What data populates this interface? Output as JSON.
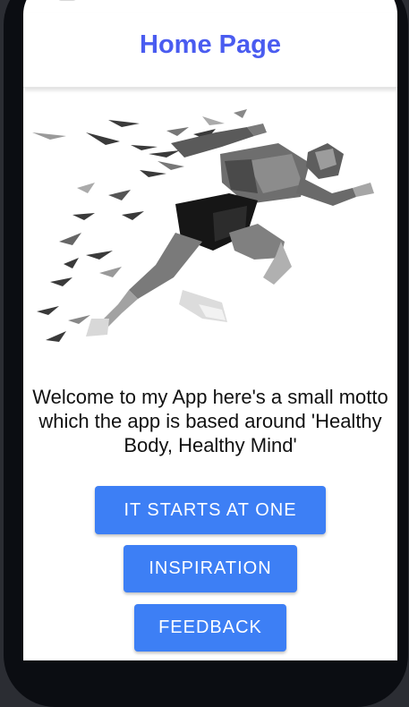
{
  "header": {
    "title": "Home Page"
  },
  "hero": {
    "image": "running-athlete-lowpoly-illustration"
  },
  "motto": {
    "text": "Welcome to my App here's a small motto which the app is based around 'Healthy Body, Healthy Mind'"
  },
  "buttons": {
    "starts": "IT STARTS AT ONE",
    "inspiration": "INSPIRATION",
    "feedback": "FEEDBACK"
  },
  "colors": {
    "title": "#4a5cf0",
    "button": "#3d7ff5",
    "button_text": "#ffffff"
  }
}
